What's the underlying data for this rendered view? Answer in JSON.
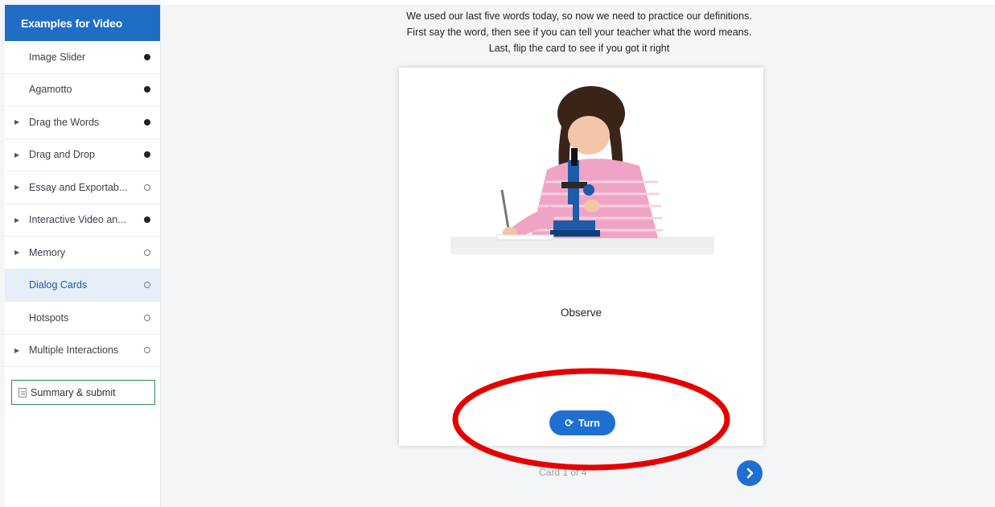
{
  "sidebar": {
    "title": "Examples for Video",
    "items": [
      {
        "label": "Image Slider",
        "expandable": false,
        "status": "done"
      },
      {
        "label": "Agamotto",
        "expandable": false,
        "status": "done"
      },
      {
        "label": "Drag the Words",
        "expandable": true,
        "status": "done"
      },
      {
        "label": "Drag and Drop",
        "expandable": true,
        "status": "done"
      },
      {
        "label": "Essay and Exportab...",
        "expandable": true,
        "status": "empty"
      },
      {
        "label": "Interactive Video an...",
        "expandable": true,
        "status": "done"
      },
      {
        "label": "Memory",
        "expandable": true,
        "status": "empty"
      },
      {
        "label": "Dialog Cards",
        "expandable": false,
        "status": "empty",
        "active": true
      },
      {
        "label": "Hotspots",
        "expandable": false,
        "status": "empty"
      },
      {
        "label": "Multiple Interactions",
        "expandable": true,
        "status": "empty"
      }
    ],
    "summary_label": "Summary & submit"
  },
  "main": {
    "instructions": [
      "We used our last five words today, so now we need to practice our definitions.",
      "First say the word, then see if you can tell your teacher what the word means.",
      "Last, flip the card to see if you got it right"
    ],
    "card": {
      "image_icon": "girl-with-microscope-image",
      "word": "Observe",
      "turn_label": "Turn",
      "turn_icon": "refresh-icon"
    },
    "counter": "Card 1 of 4",
    "next_icon": "chevron-right-icon"
  },
  "colors": {
    "header_blue": "#1f6dc5",
    "button_blue": "#1f6fd1",
    "active_bg": "#e6eef8",
    "summary_border": "#2e8a57",
    "annotation_red": "#e60000"
  }
}
